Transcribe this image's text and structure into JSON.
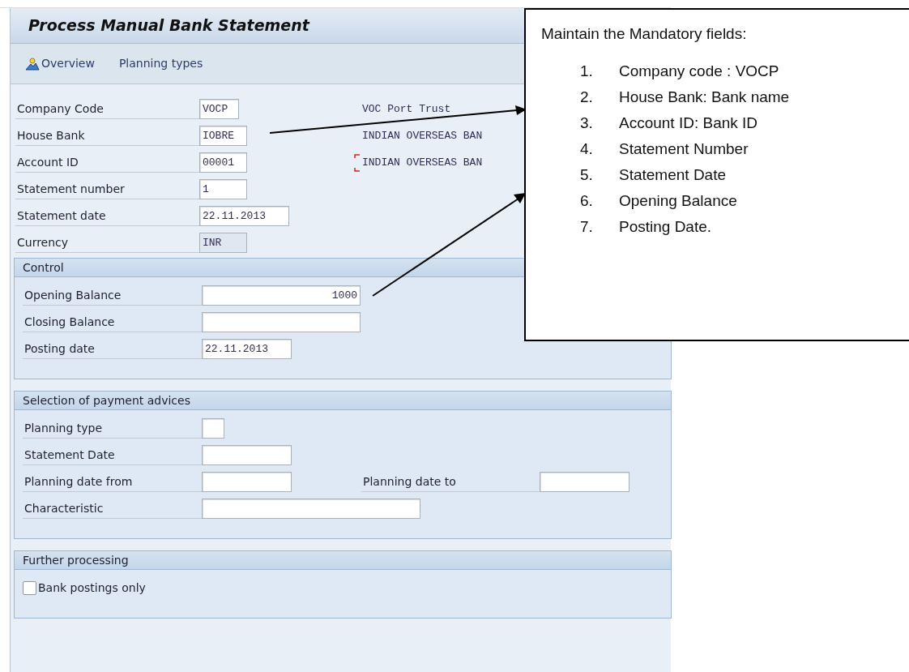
{
  "window": {
    "title": "Process Manual Bank Statement"
  },
  "toolbar": [
    {
      "label": "Overview",
      "icon": true
    },
    {
      "label": "Planning types",
      "icon": false
    }
  ],
  "header_fields": [
    {
      "label": "Company Code",
      "value": "VOCP",
      "kind": "input",
      "description": "VOC Port Trust",
      "focused": false
    },
    {
      "label": "House Bank",
      "value": "IOBRE",
      "kind": "input",
      "description": "INDIAN OVERSEAS BAN",
      "focused": false
    },
    {
      "label": "Account ID",
      "value": "00001",
      "kind": "input",
      "description": "INDIAN OVERSEAS BAN",
      "focused": true
    },
    {
      "label": "Statement number",
      "value": "1",
      "kind": "input"
    },
    {
      "label": "Statement date",
      "value": "22.11.2013",
      "kind": "input"
    },
    {
      "label": "Currency",
      "value": "INR",
      "kind": "display"
    }
  ],
  "groups": [
    {
      "title": "Control",
      "rows": [
        {
          "label": "Opening Balance",
          "value": "1000",
          "kind": "amount"
        },
        {
          "label": "Closing Balance",
          "kind": "amount"
        },
        {
          "label": "Posting date",
          "value": "22.11.2013",
          "kind": "input"
        }
      ]
    },
    {
      "title": "Selection of payment advices",
      "rows": [
        {
          "label": "Planning type",
          "kind": "input"
        },
        {
          "label": "Statement Date",
          "kind": "input"
        },
        {
          "label": "Planning date from",
          "kind": "input",
          "second_label": "Planning date to"
        },
        {
          "label": "Characteristic",
          "kind": "input"
        }
      ]
    },
    {
      "title": "Further processing",
      "rows": [
        {
          "label": "Bank postings only",
          "kind": "checkbox",
          "checked": false
        }
      ]
    }
  ],
  "callout": {
    "heading": "Maintain the Mandatory fields:",
    "items": [
      {
        "number": "1.",
        "text": "Company code : VOCP"
      },
      {
        "number": "2.",
        "text": "House Bank: Bank name"
      },
      {
        "number": "3.",
        "text": "Account ID: Bank ID"
      },
      {
        "number": "4.",
        "text": "Statement Number"
      },
      {
        "number": "5.",
        "text": "Statement Date"
      },
      {
        "number": "6.",
        "text": "Opening Balance"
      },
      {
        "number": "7.",
        "text": "Posting Date."
      }
    ]
  }
}
